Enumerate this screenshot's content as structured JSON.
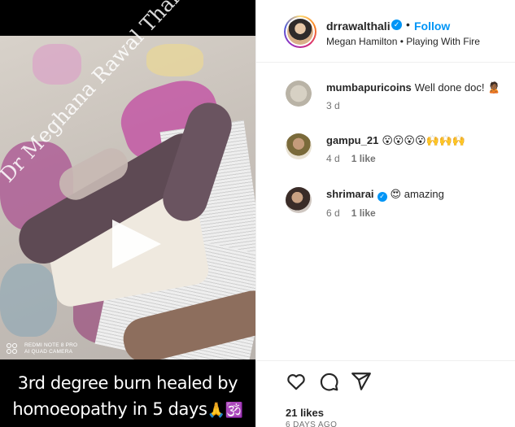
{
  "post": {
    "media": {
      "watermark": "Dr Meghana Rawal Thali",
      "camera_line1": "REDMI NOTE 8 PRO",
      "camera_line2": "AI QUAD CAMERA",
      "caption_line1": "3rd degree burn healed by",
      "caption_line2": "homoeopathy in 5 days",
      "caption_emojis": "🙏🕉️",
      "play_icon": "play-icon"
    },
    "author": {
      "username": "drrawalthali",
      "verified": true,
      "follow_label": "Follow",
      "separator": "•",
      "audio_artist": "Megan Hamilton",
      "audio_track": "Playing With Fire",
      "audio_separator": "•"
    },
    "comments": [
      {
        "username": "mumbapuricoins",
        "verified": false,
        "text": "Well done doc! 🙎🏾",
        "time": "3 d",
        "likes": ""
      },
      {
        "username": "gampu_21",
        "verified": false,
        "text": "😮😮😮😮🙌🙌🙌",
        "time": "4 d",
        "likes": "1 like"
      },
      {
        "username": "shrimarai",
        "verified": true,
        "text": "😍 amazing",
        "time": "6 d",
        "likes": "1 like"
      }
    ],
    "actions": {
      "like_icon": "heart-icon",
      "comment_icon": "comment-icon",
      "share_icon": "share-icon"
    },
    "likes_count": "21 likes",
    "date": "6 DAYS AGO",
    "colors": {
      "accent": "#0095f6",
      "text": "#262626",
      "muted": "#737373",
      "border": "#efefef"
    }
  }
}
